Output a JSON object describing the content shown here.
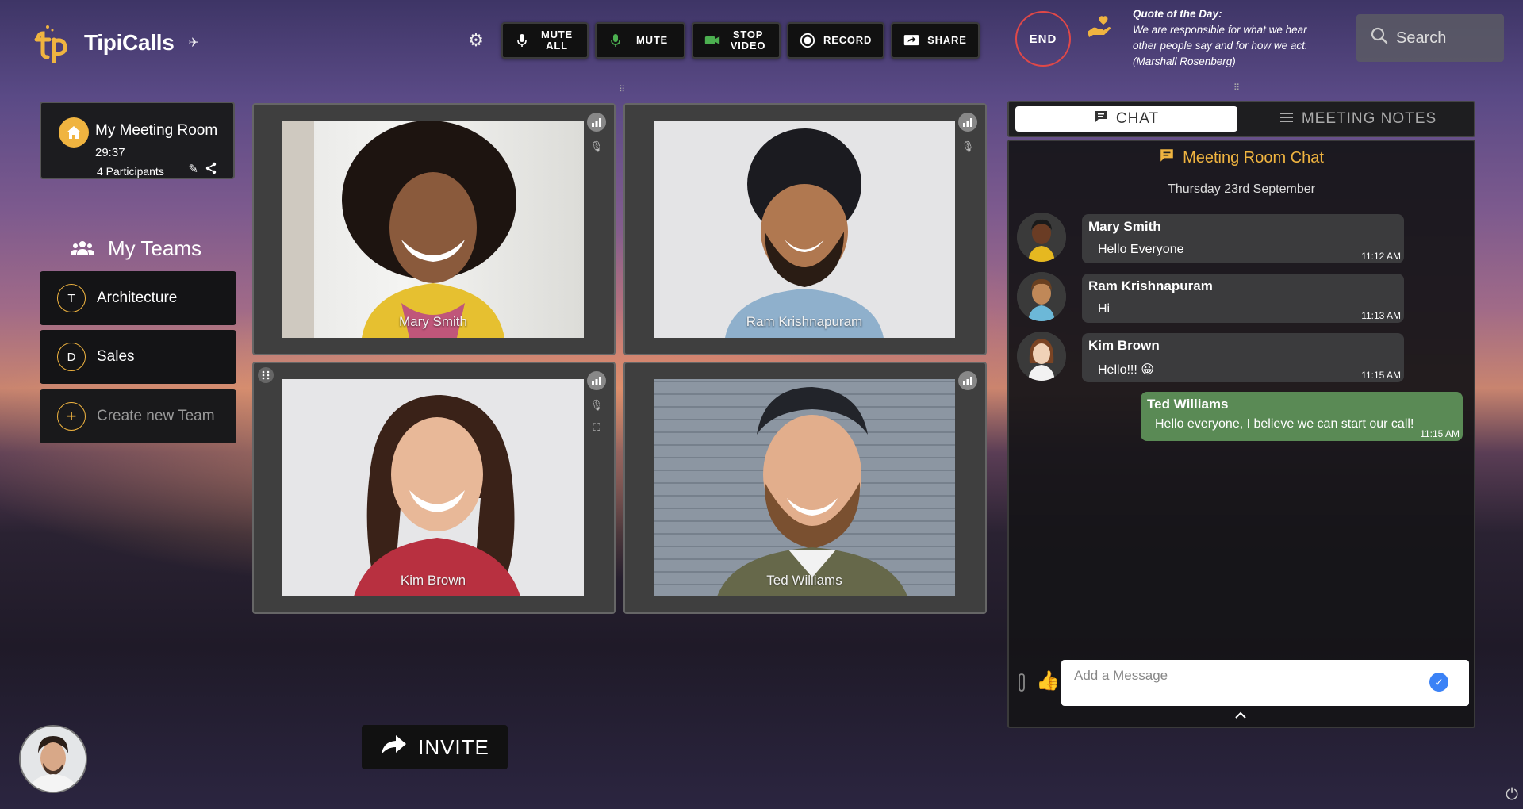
{
  "app": {
    "name": "TipiCalls",
    "spark": "✈"
  },
  "toolbar": {
    "mute_all": "MUTE ALL",
    "mute": "MUTE",
    "stop_video": "STOP VIDEO",
    "record": "RECORD",
    "share": "SHARE",
    "end": "END"
  },
  "quote": {
    "heading": "Quote of the Day:",
    "text": "We are responsible for what we hear other people say and for how we act. (Marshall Rosenberg)"
  },
  "search": {
    "placeholder": "Search"
  },
  "room": {
    "name": "My Meeting Room",
    "time": "29:37",
    "participants": "4 Participants"
  },
  "teams": {
    "title": "My Teams",
    "items": [
      {
        "badge": "T",
        "label": "Architecture"
      },
      {
        "badge": "D",
        "label": "Sales"
      }
    ],
    "create_label": "Create new Team",
    "create_badge": "+"
  },
  "participants": [
    {
      "name": "Mary Smith"
    },
    {
      "name": "Ram Krishnapuram"
    },
    {
      "name": "Kim Brown"
    },
    {
      "name": "Ted Williams"
    }
  ],
  "invite": {
    "label": "INVITE"
  },
  "chat": {
    "tab_chat": "CHAT",
    "tab_notes": "MEETING NOTES",
    "title": "Meeting Room Chat",
    "date": "Thursday 23rd September",
    "messages": [
      {
        "author": "Mary Smith",
        "text": "Hello Everyone",
        "time": "11:12 AM"
      },
      {
        "author": "Ram Krishnapuram",
        "text": "Hi",
        "time": "11:13 AM"
      },
      {
        "author": "Kim Brown",
        "text": "Hello!!! 😀",
        "time": "11:15 AM"
      },
      {
        "author": "Ted Williams",
        "text": "Hello everyone, I believe we can start our call!",
        "time": "11:15 AM"
      }
    ],
    "composer_placeholder": "Add a Message"
  },
  "colors": {
    "accent": "#f0b440",
    "end": "#e04848",
    "own_message": "#5a8a55"
  }
}
